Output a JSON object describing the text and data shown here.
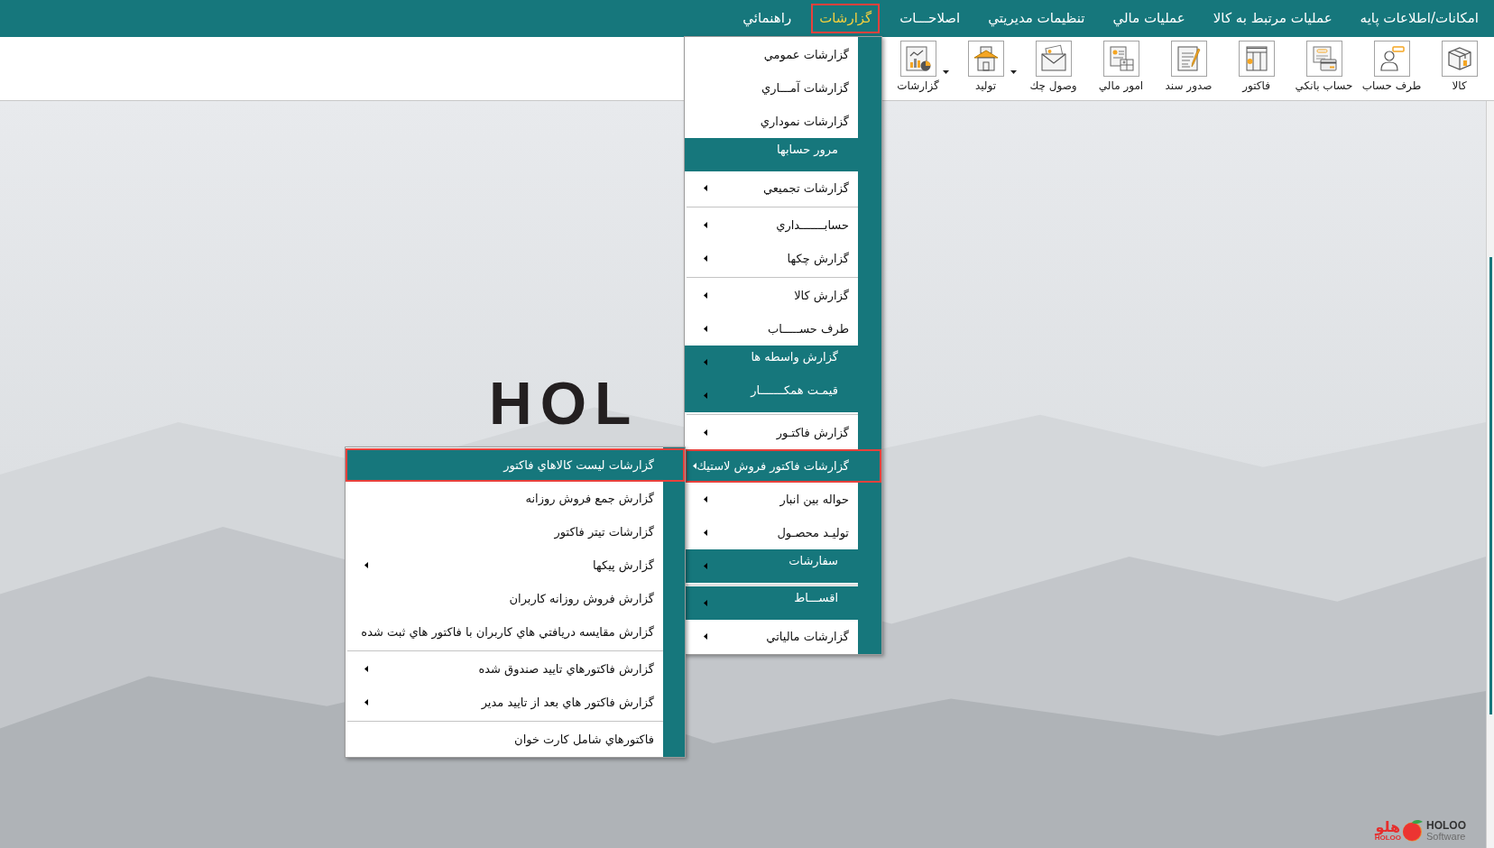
{
  "menu_bar": {
    "items": [
      {
        "label": "امكانات/اطلاعات پايه",
        "selected": false
      },
      {
        "label": "عمليات مرتبط به كالا",
        "selected": false
      },
      {
        "label": "عمليات مالي",
        "selected": false
      },
      {
        "label": "تنظيمات مديريتي",
        "selected": false
      },
      {
        "label": "اصلاحـــات",
        "selected": false
      },
      {
        "label": "گزارشات",
        "selected": true
      },
      {
        "label": "راهنمائي",
        "selected": false
      }
    ]
  },
  "toolbar": {
    "buttons": [
      {
        "label": "كالا",
        "dropdown": false
      },
      {
        "label": "طرف حساب",
        "dropdown": false
      },
      {
        "label": "حساب بانكي",
        "dropdown": false
      },
      {
        "label": "فاكتور",
        "dropdown": false
      },
      {
        "label": "صدور سند",
        "dropdown": false
      },
      {
        "label": "امور مالي",
        "dropdown": false
      },
      {
        "label": "وصول چك",
        "dropdown": false
      },
      {
        "label": "توليد",
        "dropdown": true
      },
      {
        "label": "گزارشات",
        "dropdown": true
      }
    ]
  },
  "reports_menu": {
    "items": [
      {
        "kind": "item",
        "label": "گزارشات عمومي",
        "submenu": false,
        "selected": false
      },
      {
        "kind": "item",
        "label": "گزارشات آمـــاري",
        "submenu": false,
        "selected": false
      },
      {
        "kind": "item",
        "label": "گزارشات نموداري",
        "submenu": false,
        "selected": false
      },
      {
        "kind": "band",
        "label": "مرور حسابها",
        "submenu": false,
        "selected": false
      },
      {
        "kind": "item",
        "label": "گزارشات تجميعي",
        "submenu": true,
        "selected": false
      },
      {
        "kind": "separator"
      },
      {
        "kind": "item",
        "label": "حسابـــــــداري",
        "submenu": true,
        "selected": false
      },
      {
        "kind": "item",
        "label": "گزارش چكها",
        "submenu": true,
        "selected": false
      },
      {
        "kind": "separator"
      },
      {
        "kind": "item",
        "label": "گزارش كالا",
        "submenu": true,
        "selected": false
      },
      {
        "kind": "item",
        "label": "طرف حســـــاب",
        "submenu": true,
        "selected": false
      },
      {
        "kind": "band",
        "label": "گزارش واسطه ها",
        "submenu": true,
        "selected": false
      },
      {
        "kind": "band",
        "label": "قيمـت همكـــــــار",
        "submenu": true,
        "selected": false
      },
      {
        "kind": "separator"
      },
      {
        "kind": "item",
        "label": "گزارش فاكتـور",
        "submenu": true,
        "selected": false
      },
      {
        "kind": "item",
        "label": "گزارشات فاكتور فروش لاستيك",
        "submenu": true,
        "selected": true
      },
      {
        "kind": "item",
        "label": "حواله بين انبار",
        "submenu": true,
        "selected": false
      },
      {
        "kind": "item",
        "label": "توليـد محصـول",
        "submenu": true,
        "selected": false
      },
      {
        "kind": "band",
        "label": "سفارشات",
        "submenu": true,
        "selected": false
      },
      {
        "kind": "separator"
      },
      {
        "kind": "band",
        "label": "اقســـاط",
        "submenu": true,
        "selected": false
      },
      {
        "kind": "item",
        "label": "گزارشات مالياتي",
        "submenu": true,
        "selected": false
      }
    ]
  },
  "submenu": {
    "items": [
      {
        "kind": "item",
        "label": "گزارشات ليست كالاهاي فاكتور",
        "submenu": false,
        "selected": true
      },
      {
        "kind": "item",
        "label": "گزارش جمع فروش روزانه",
        "submenu": false,
        "selected": false
      },
      {
        "kind": "item",
        "label": "گزارشات تيتر فاكتور",
        "submenu": false,
        "selected": false
      },
      {
        "kind": "item",
        "label": "گزارش پيكها",
        "submenu": true,
        "selected": false
      },
      {
        "kind": "item",
        "label": "گزارش فروش روزانه كاربران",
        "submenu": false,
        "selected": false
      },
      {
        "kind": "item",
        "label": "گزارش مقايسه دريافتي هاي كاربران با فاكتور هاي ثبت شده",
        "submenu": false,
        "selected": false
      },
      {
        "kind": "separator"
      },
      {
        "kind": "item",
        "label": "گزارش فاكتورهاي تاييد صندوق شده",
        "submenu": true,
        "selected": false
      },
      {
        "kind": "item",
        "label": "گزارش فاكتور هاي بعد از تاييد مدير",
        "submenu": true,
        "selected": false
      },
      {
        "kind": "separator"
      },
      {
        "kind": "item",
        "label": "فاكتورهاي شامل كارت خوان",
        "submenu": false,
        "selected": false
      }
    ]
  },
  "wallpaper": {
    "logo_text": "HOL"
  },
  "brand_logo": {
    "persian_name": "هلو",
    "small_text": "HOLOO",
    "name": "HOLOO",
    "tagline": "Software"
  }
}
